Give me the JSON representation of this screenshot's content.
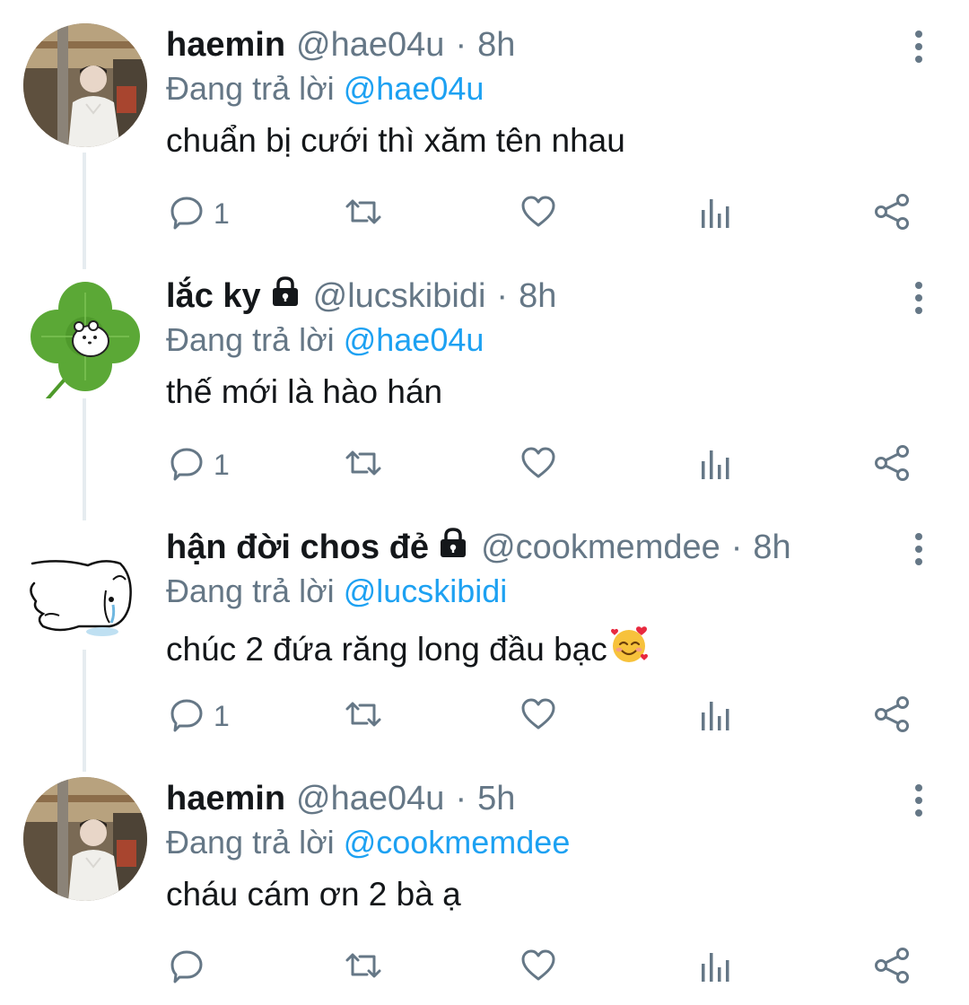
{
  "colors": {
    "text_primary": "#14171a",
    "text_secondary": "#657786",
    "mention": "#1da1f2",
    "icon": "#657786",
    "thread_line": "#e6ecf0"
  },
  "tweets": [
    {
      "name": "haemin",
      "handle": "@hae04u",
      "separator": "·",
      "time": "8h",
      "locked": false,
      "replying_prefix": "Đang trả lời",
      "replying_to": "@hae04u",
      "text": "chuẩn bị cưới thì xăm tên nhau",
      "reply_count": "1",
      "avatar": "photo-person-white-hoodie"
    },
    {
      "name": "lắc ky",
      "handle": "@lucskibidi",
      "separator": "·",
      "time": "8h",
      "locked": true,
      "replying_prefix": "Đang trả lời",
      "replying_to": "@hae04u",
      "text": "thế mới là hào hán",
      "reply_count": "1",
      "avatar": "clover-bear"
    },
    {
      "name": "hận đời chos đẻ",
      "handle": "@cookmemdee",
      "separator": "·",
      "time": "8h",
      "locked": true,
      "replying_prefix": "Đang trả lời",
      "replying_to": "@lucskibidi",
      "text": "chúc 2 đứa răng long đầu bạc",
      "emoji": "smiling-face-with-hearts",
      "reply_count": "1",
      "avatar": "crying-dog-sketch"
    },
    {
      "name": "haemin",
      "handle": "@hae04u",
      "separator": "·",
      "time": "5h",
      "locked": false,
      "replying_prefix": "Đang trả lời",
      "replying_to": "@cookmemdee",
      "text": "cháu cám ơn 2 bà ạ",
      "reply_count": "",
      "avatar": "photo-person-white-hoodie"
    }
  ],
  "action_icons": [
    "reply-icon",
    "retweet-icon",
    "like-icon",
    "analytics-icon",
    "share-icon"
  ]
}
